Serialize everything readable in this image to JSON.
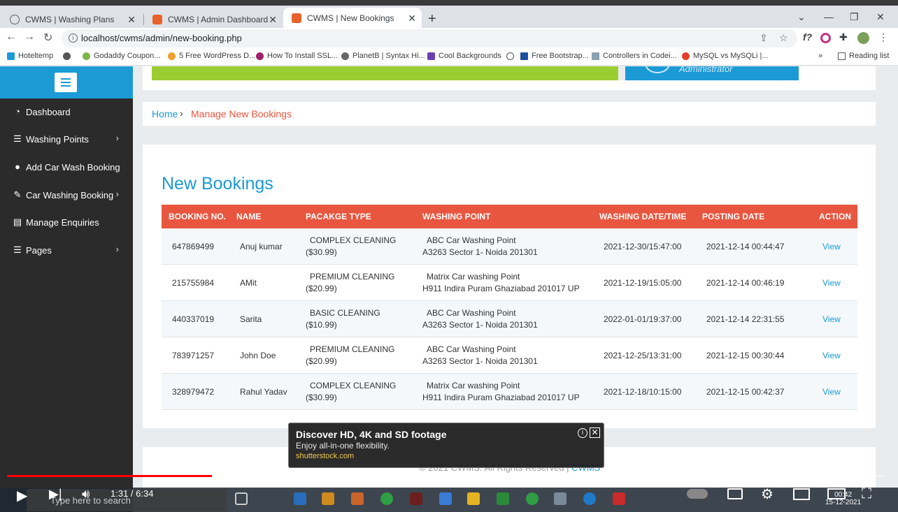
{
  "browser": {
    "tabs": [
      {
        "title": "CWMS | Washing Plans",
        "active": false
      },
      {
        "title": "CWMS | Admin Dashboard",
        "active": false
      },
      {
        "title": "CWMS | New Bookings",
        "active": true
      }
    ],
    "url": "localhost/cwms/admin/new-booking.php",
    "bookmarks": [
      "Hoteltemp",
      "Godaddy Coupon...",
      "5 Free WordPress D...",
      "How To Install SSL...",
      "PlanetB | Syntax Hi...",
      "Cool Backgrounds",
      "Free Bootstrap...",
      "Controllers in Codei...",
      "MySQL vs MySQLi |...",
      "Reading list"
    ]
  },
  "sidebar": {
    "items": [
      {
        "label": "Dashboard",
        "icon": "dashboard-icon",
        "glyph": "◔",
        "has_submenu": false
      },
      {
        "label": "Washing Points",
        "icon": "list-icon",
        "glyph": "☰",
        "has_submenu": true
      },
      {
        "label": "Add Car Wash Booking",
        "icon": "user-icon",
        "glyph": "●",
        "has_submenu": false
      },
      {
        "label": "Car Washing Booking",
        "icon": "edit-icon",
        "glyph": "✎",
        "has_submenu": true
      },
      {
        "label": "Manage Enquiries",
        "icon": "file-icon",
        "glyph": "▤",
        "has_submenu": false
      },
      {
        "label": "Pages",
        "icon": "list-icon",
        "glyph": "☰",
        "has_submenu": true
      }
    ]
  },
  "header": {
    "admin_label": "Administrator"
  },
  "breadcrumb": {
    "home": "Home",
    "current": "Manage New Bookings"
  },
  "main": {
    "title": "New Bookings",
    "columns": [
      "BOOKING NO.",
      "NAME",
      "PACAKGE TYPE",
      "WASHING POINT",
      "WASHING DATE/TIME",
      "POSTING DATE",
      "ACTION"
    ],
    "rows": [
      {
        "booking_no": "647869499",
        "name": "Anuj kumar",
        "package": "COMPLEX CLEANING",
        "price": "($30.99)",
        "point": "ABC Car Washing Point",
        "address": "A3263 Sector 1- Noida 201301",
        "wash_date": "2021-12-30/15:47:00",
        "posting_date": "2021-12-14 00:44:47",
        "action": "View"
      },
      {
        "booking_no": "215755984",
        "name": "AMit",
        "package": "PREMIUM CLEANING",
        "price": "($20.99)",
        "point": "Matrix Car washing Point",
        "address": "H911 Indira Puram Ghaziabad 201017 UP",
        "wash_date": "2021-12-19/15:05:00",
        "posting_date": "2021-12-14 00:46:19",
        "action": "View"
      },
      {
        "booking_no": "440337019",
        "name": "Sarita",
        "package": "BASIC CLEANING",
        "price": "($10.99)",
        "point": "ABC Car Washing Point",
        "address": "A3263 Sector 1- Noida 201301",
        "wash_date": "2022-01-01/19:37:00",
        "posting_date": "2021-12-14 22:31:55",
        "action": "View"
      },
      {
        "booking_no": "783971257",
        "name": "John Doe",
        "package": "PREMIUM CLEANING",
        "price": "($20.99)",
        "point": "ABC Car Washing Point",
        "address": "A3263 Sector 1- Noida 201301",
        "wash_date": "2021-12-25/13:31:00",
        "posting_date": "2021-12-15 00:30:44",
        "action": "View"
      },
      {
        "booking_no": "328979472",
        "name": "Rahul Yadav",
        "package": "COMPLEX CLEANING",
        "price": "($30.99)",
        "point": "Matrix Car washing Point",
        "address": "H911 Indira Puram Ghaziabad 201017 UP",
        "wash_date": "2021-12-18/10:15:00",
        "posting_date": "2021-12-15 00:42:37",
        "action": "View"
      }
    ]
  },
  "footer": {
    "copyright": "© 2021 CWMS. All Rights Reserved |",
    "brand": "CWMS"
  },
  "ad": {
    "title": "Discover HD, 4K and SD footage",
    "subtitle": "Enjoy all-in-one flexibility.",
    "link": "shutterstock.com"
  },
  "video": {
    "time": "1:31 / 6:34",
    "played_fraction": 0.233,
    "buffered_fraction": 0.31
  },
  "taskbar": {
    "search_placeholder": "Type here to search",
    "time": "00:42",
    "date": "15-12-2021"
  },
  "colors": {
    "accent": "#1b9ad6",
    "table_header": "#e8563f",
    "sidebar": "#2b2b2b"
  }
}
